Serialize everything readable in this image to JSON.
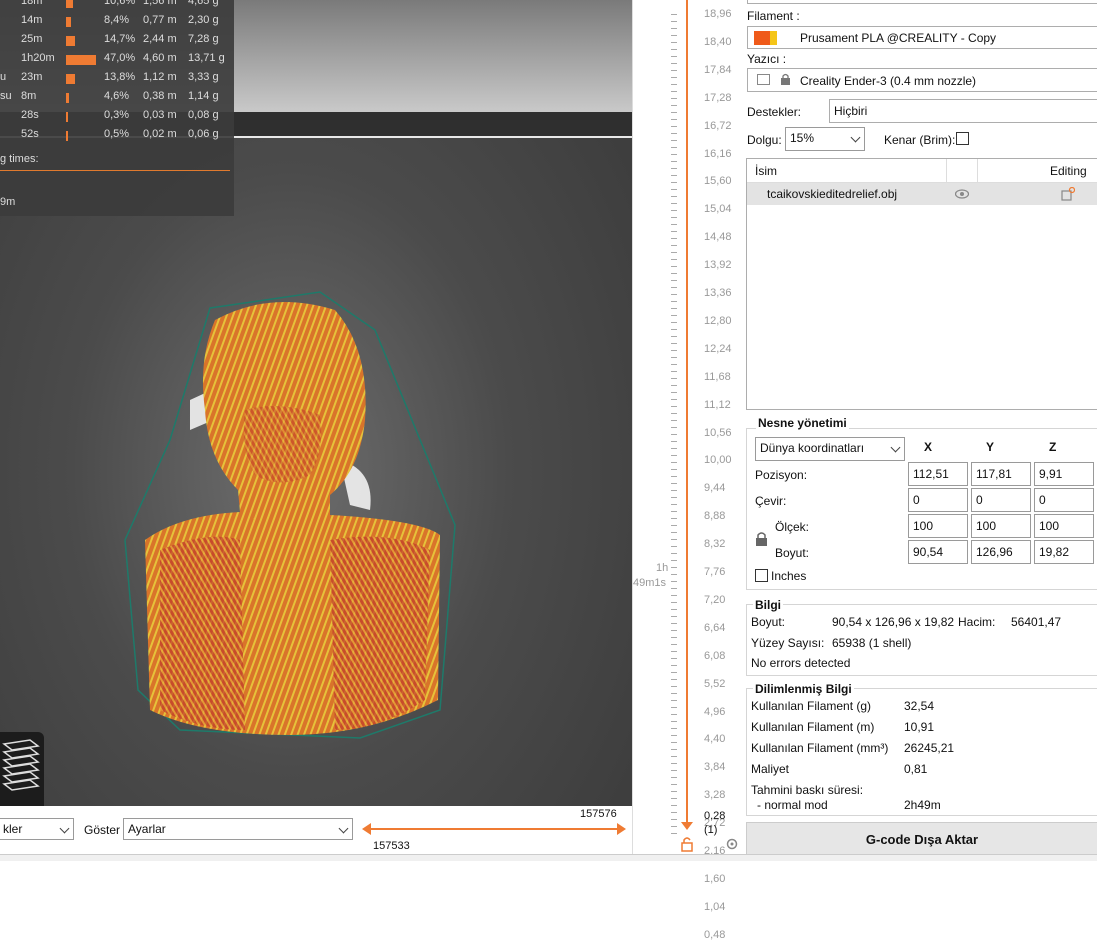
{
  "legend": {
    "rows": [
      {
        "name": "",
        "time": "18m",
        "pct": "10,6%",
        "meters": "1,56 m",
        "grams": "4,65 g",
        "fill": 0.106
      },
      {
        "name": "",
        "time": "14m",
        "pct": "8,4%",
        "meters": "0,77 m",
        "grams": "2,30 g",
        "fill": 0.084
      },
      {
        "name": "",
        "time": "25m",
        "pct": "14,7%",
        "meters": "2,44 m",
        "grams": "7,28 g",
        "fill": 0.147
      },
      {
        "name": "",
        "time": "1h20m",
        "pct": "47,0%",
        "meters": "4,60 m",
        "grams": "13,71 g",
        "fill": 0.47
      },
      {
        "name": "u",
        "time": "23m",
        "pct": "13,8%",
        "meters": "1,12 m",
        "grams": "3,33 g",
        "fill": 0.138
      },
      {
        "name": "su",
        "time": "8m",
        "pct": "4,6%",
        "meters": "0,38 m",
        "grams": "1,14 g",
        "fill": 0.046
      },
      {
        "name": "",
        "time": "28s",
        "pct": "0,3%",
        "meters": "0,03 m",
        "grams": "0,08 g",
        "fill": 0.003
      },
      {
        "name": "",
        "time": "52s",
        "pct": "0,5%",
        "meters": "0,02 m",
        "grams": "0,06 g",
        "fill": 0.005
      }
    ],
    "times_label": "g times:",
    "time_value": "9m"
  },
  "bottom": {
    "view_combo": "kler",
    "show_label": "Göster",
    "show_combo": "Ayarlar",
    "range_top": "157576",
    "range_bottom": "157533"
  },
  "ruler": {
    "labels": [
      "18,96",
      "18,40",
      "17,84",
      "17,28",
      "16,72",
      "16,16",
      "15,60",
      "15,04",
      "14,48",
      "13,92",
      "13,36",
      "12,80",
      "12,24",
      "11,68",
      "11,12",
      "10,56",
      "10,00",
      "9,44",
      "8,88",
      "8,32",
      "7,76",
      "7,20",
      "6,64",
      "6,08",
      "5,52",
      "4,96",
      "4,40",
      "3,84",
      "3,28",
      "2,72",
      "2,16",
      "1,60",
      "1,04",
      "0,48"
    ],
    "bottom_value": "0,28",
    "bottom_count": "(1)",
    "estimate_1": "1h",
    "estimate_2": "49m1s"
  },
  "panel": {
    "filament_label": "Filament :",
    "filament_value": "Prusament PLA @CREALITY - Copy",
    "printer_label": "Yazıcı :",
    "printer_value": "Creality Ender-3 (0.4 mm nozzle)",
    "supports_label": "Destekler:",
    "supports_value": "Hiçbiri",
    "infill_label": "Dolgu:",
    "infill_value": "15%",
    "brim_label": "Kenar (Brim):",
    "list_header_name": "İsim",
    "list_header_editing": "Editing",
    "object_name": "tcaikovskieditedrelief.obj",
    "object_mgmt": {
      "title": "Nesne yönetimi",
      "coords": "Dünya koordinatları",
      "x": "X",
      "y": "Y",
      "z": "Z",
      "position_label": "Pozisyon:",
      "position": [
        "112,51",
        "117,81",
        "9,91"
      ],
      "rotate_label": "Çevir:",
      "rotate": [
        "0",
        "0",
        "0"
      ],
      "scale_label": "Ölçek:",
      "scale": [
        "100",
        "100",
        "100"
      ],
      "size_label": "Boyut:",
      "size": [
        "90,54",
        "126,96",
        "19,82"
      ],
      "inches_label": "Inches"
    },
    "info": {
      "title": "Bilgi",
      "size_label": "Boyut:",
      "size_value": "90,54 x 126,96 x 19,82",
      "volume_label": "Hacim:",
      "volume_value": "56401,47",
      "facets_label": "Yüzey Sayısı:",
      "facets_value": "65938 (1 shell)",
      "errors": "No errors detected"
    },
    "sliced": {
      "title": "Dilimlenmiş Bilgi",
      "rows": [
        {
          "label": "Kullanılan Filament (g)",
          "value": "32,54"
        },
        {
          "label": "Kullanılan Filament (m)",
          "value": "10,91"
        },
        {
          "label": "Kullanılan Filament (mm³)",
          "value": "26245,21"
        },
        {
          "label": "Maliyet",
          "value": "0,81"
        }
      ],
      "est_label": "Tahmini baskı süresi:",
      "mode_label": "- normal mod",
      "mode_value": "2h49m"
    },
    "export_button": "G-code Dışa Aktar"
  },
  "colors": {
    "accent": "#ef7b33",
    "model_orange": "#d9742a",
    "model_red": "#c0392b",
    "model_yellow": "#e6c23a"
  }
}
